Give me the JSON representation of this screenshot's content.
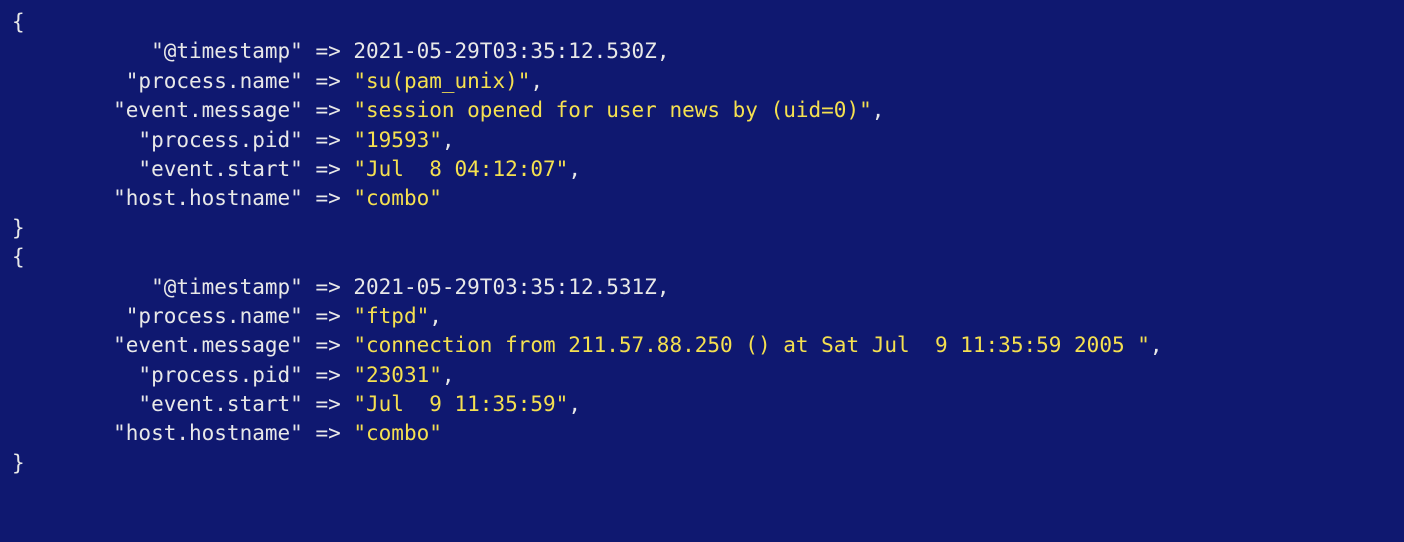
{
  "records": [
    {
      "fields": [
        {
          "key": "\"@timestamp\"",
          "arrow": "=>",
          "value": "2021-05-29T03:35:12.530Z",
          "quoted": false,
          "trailing_comma": true
        },
        {
          "key": "\"process.name\"",
          "arrow": "=>",
          "value": "\"su(pam_unix)\"",
          "quoted": true,
          "trailing_comma": true
        },
        {
          "key": "\"event.message\"",
          "arrow": "=>",
          "value": "\"session opened for user news by (uid=0)\"",
          "quoted": true,
          "trailing_comma": true
        },
        {
          "key": "\"process.pid\"",
          "arrow": "=>",
          "value": "\"19593\"",
          "quoted": true,
          "trailing_comma": true
        },
        {
          "key": "\"event.start\"",
          "arrow": "=>",
          "value": "\"Jul  8 04:12:07\"",
          "quoted": true,
          "trailing_comma": true
        },
        {
          "key": "\"host.hostname\"",
          "arrow": "=>",
          "value": "\"combo\"",
          "quoted": true,
          "trailing_comma": false
        }
      ]
    },
    {
      "fields": [
        {
          "key": "\"@timestamp\"",
          "arrow": "=>",
          "value": "2021-05-29T03:35:12.531Z",
          "quoted": false,
          "trailing_comma": true
        },
        {
          "key": "\"process.name\"",
          "arrow": "=>",
          "value": "\"ftpd\"",
          "quoted": true,
          "trailing_comma": true
        },
        {
          "key": "\"event.message\"",
          "arrow": "=>",
          "value": "\"connection from 211.57.88.250 () at Sat Jul  9 11:35:59 2005 \"",
          "quoted": true,
          "trailing_comma": true
        },
        {
          "key": "\"process.pid\"",
          "arrow": "=>",
          "value": "\"23031\"",
          "quoted": true,
          "trailing_comma": true
        },
        {
          "key": "\"event.start\"",
          "arrow": "=>",
          "value": "\"Jul  9 11:35:59\"",
          "quoted": true,
          "trailing_comma": true
        },
        {
          "key": "\"host.hostname\"",
          "arrow": "=>",
          "value": "\"combo\"",
          "quoted": true,
          "trailing_comma": false
        }
      ]
    }
  ],
  "layout": {
    "arrow_column": 24
  }
}
